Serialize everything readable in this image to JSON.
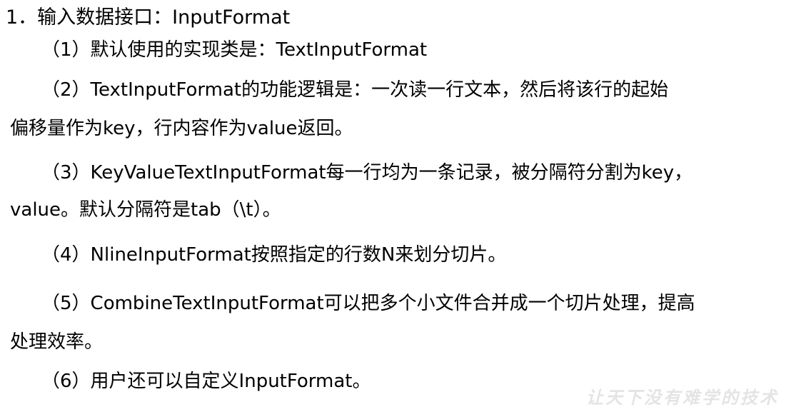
{
  "heading": "1．输入数据接口：InputFormat",
  "items": [
    {
      "num": "（1）",
      "line1": "默认使用的实现类是：TextInputFormat"
    },
    {
      "num": "（2）",
      "line1": "TextInputFormat的功能逻辑是：一次读一行文本，然后将该行的起始",
      "line2": "偏移量作为key，行内容作为value返回。"
    },
    {
      "num": "（3）",
      "line1": "KeyValueTextInputFormat每一行均为一条记录，被分隔符分割为key，",
      "line2": "value。默认分隔符是tab（\\t）。"
    },
    {
      "num": "（4）",
      "line1": "NlineInputFormat按照指定的行数N来划分切片。"
    },
    {
      "num": "（5）",
      "line1": "CombineTextInputFormat可以把多个小文件合并成一个切片处理，提高",
      "line2": "处理效率。"
    },
    {
      "num": "（6）",
      "line1": "用户还可以自定义InputFormat。"
    }
  ],
  "watermark": "让天下没有难学的技术"
}
